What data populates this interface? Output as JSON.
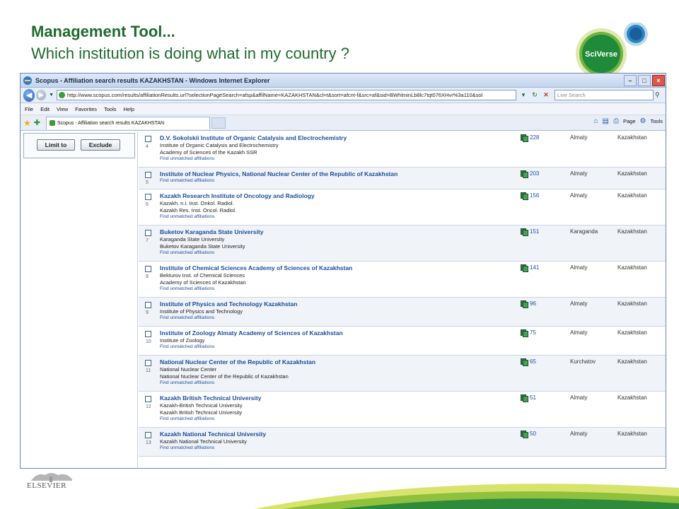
{
  "slide": {
    "title": "Management Tool...",
    "subtitle": "Which institution is doing what in my country ?",
    "logo_text": "SciVerse",
    "footer_logo": "ELSEVIER"
  },
  "browser": {
    "window_title": "Scopus - Affiliation search results KAZAKHSTAN - Windows Internet Explorer",
    "url": "http://www.scopus.com/results/affiliationResults.url?selectionPageSearch=afsp&affilName=KAZAKHSTAN&cl=t&sort=afcnt-f&src=af&sid=BWhlminLb8lc7tqt076XHvr%3a110&sol",
    "search_placeholder": "Live Search",
    "menu": [
      "File",
      "Edit",
      "View",
      "Favorites",
      "Tools",
      "Help"
    ],
    "tab_label": "Scopus - Affiliation search results KAZAKHSTAN",
    "cmd_page": "Page",
    "cmd_tools": "Tools"
  },
  "filters": {
    "limit_label": "Limit to",
    "exclude_label": "Exclude"
  },
  "find_unmatched_label": "Find unmatched affiliations",
  "results": [
    {
      "num": "4",
      "name": "D.V. Sokolskii Institute of Organic Catalysis and Electrochemistry",
      "aliases": [
        "Institute of Organic Catalysis and Electrochemistry",
        "Academy of Sciences of the Kazakh SSR"
      ],
      "docs": "228",
      "city": "Almaty",
      "country": "Kazakhstan"
    },
    {
      "num": "5",
      "name": "Institute of Nuclear Physics, National Nuclear Center of the Republic of Kazakhstan",
      "aliases": [],
      "docs": "203",
      "city": "Almaty",
      "country": "Kazakhstan"
    },
    {
      "num": "6",
      "name": "Kazakh Research Institute of Oncology and Radiology",
      "aliases": [
        "Kazakh. n.i. Inst. Onkol. Radiol.",
        "Kazakh Res. Inst. Oncol. Radiol."
      ],
      "docs": "156",
      "city": "Almaty",
      "country": "Kazakhstan"
    },
    {
      "num": "7",
      "name": "Buketov Karaganda State University",
      "aliases": [
        "Karaganda State University",
        "Buketov Karaganda State University"
      ],
      "docs": "151",
      "city": "Karaganda",
      "country": "Kazakhstan"
    },
    {
      "num": "8",
      "name": "Institute of Chemical Sciences Academy of Sciences of Kazakhstan",
      "aliases": [
        "Bekturov Inst. of Chemical Sciences",
        "Academy of Sciences of Kazakhstan"
      ],
      "docs": "141",
      "city": "Almaty",
      "country": "Kazakhstan"
    },
    {
      "num": "9",
      "name": "Institute of Physics and Technology Kazakhstan",
      "aliases": [
        "Institute of Physics and Technology"
      ],
      "docs": "96",
      "city": "Almaty",
      "country": "Kazakhstan"
    },
    {
      "num": "10",
      "name": "Institute of Zoology Almaty Academy of Sciences of Kazakhstan",
      "aliases": [
        "Institute of Zoology"
      ],
      "docs": "75",
      "city": "Almaty",
      "country": "Kazakhstan"
    },
    {
      "num": "11",
      "name": "National Nuclear Center of the Republic of Kazakhstan",
      "aliases": [
        "National Nuclear Center",
        "National Nuclear Center of the Republic of Kazakhstan"
      ],
      "docs": "65",
      "city": "Kurchatov",
      "country": "Kazakhstan"
    },
    {
      "num": "12",
      "name": "Kazakh British Technical University",
      "aliases": [
        "Kazakh-British Technical University",
        "Kazakh British Technical University"
      ],
      "docs": "51",
      "city": "Almaty",
      "country": "Kazakhstan"
    },
    {
      "num": "13",
      "name": "Kazakh National Technical University",
      "aliases": [
        "Kazakh National Technical University"
      ],
      "docs": "50",
      "city": "Almaty",
      "country": "Kazakhstan"
    }
  ]
}
